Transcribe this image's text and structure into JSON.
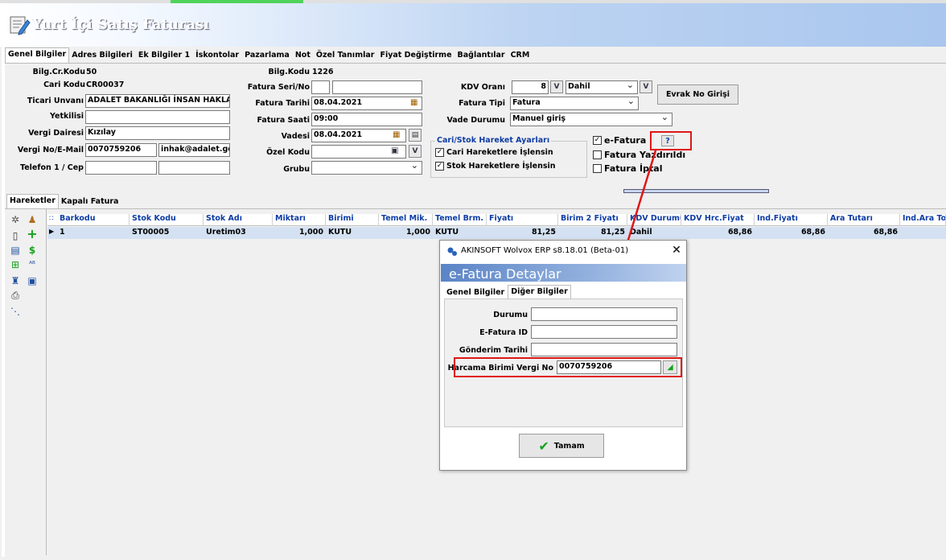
{
  "window": {
    "title": "Yurt İçi Satış Faturası"
  },
  "main_tabs": [
    "Genel Bilgiler",
    "Adres Bilgileri",
    "Ek Bilgiler 1",
    "İskontolar",
    "Pazarlama",
    "Not",
    "Özel Tanımlar",
    "Fiyat Değiştirme",
    "Bağlantılar",
    "CRM"
  ],
  "left_form": {
    "bilg_cr_kodu_label": "Bilg.Cr.Kodu",
    "bilg_cr_kodu_value": "50",
    "cari_kodu_label": "Cari Kodu",
    "cari_kodu_value": "CR00037",
    "ticari_unvani_label": "Ticari Unvanı",
    "ticari_unvani_value": "ADALET BAKANLIĞI İNSAN HAKLARI",
    "yetkilisi_label": "Yetkilisi",
    "yetkilisi_value": "",
    "vergi_dairesi_label": "Vergi Dairesi",
    "vergi_dairesi_value": "Kızılay",
    "vergi_no_label": "Vergi No/E-Mail",
    "vergi_no_value": "0070759206",
    "email_value": "inhak@adalet.gov.tr",
    "telefon_label": "Telefon 1 / Cep",
    "telefon_value": "",
    "cep_value": ""
  },
  "middle_form": {
    "bilg_kodu_label": "Bilg.Kodu",
    "bilg_kodu_value": "1226",
    "fatura_seri_label": "Fatura Seri/No",
    "fatura_seri_value": "",
    "fatura_no_value": "",
    "fatura_tarihi_label": "Fatura Tarihi",
    "fatura_tarihi_value": "08.04.2021",
    "fatura_saati_label": "Fatura Saati",
    "fatura_saati_value": "09:00",
    "vadesi_label": "Vadesi",
    "vadesi_value": "08.04.2021",
    "ozel_kodu_label": "Özel Kodu",
    "ozel_kodu_value": "",
    "grubu_label": "Grubu",
    "grubu_value": ""
  },
  "right_form": {
    "kdv_orani_label": "KDV Oranı",
    "kdv_orani_value": "8",
    "kdv_dahil_value": "Dahil",
    "fatura_tipi_label": "Fatura Tipi",
    "fatura_tipi_value": "Fatura",
    "vade_durumu_label": "Vade Durumu",
    "vade_durumu_value": "Manuel giriş",
    "evrak_button": "Evrak No Girişi",
    "v_label": "V"
  },
  "hareket_ayarlari": {
    "title": "Cari/Stok Hareket Ayarları",
    "cari_label": "Cari Hareketlere İşlensin",
    "stok_label": "Stok Hareketlere İşlensin"
  },
  "flags": {
    "efatura_label": "e-Fatura",
    "help_label": "?",
    "yazdirildi_label": "Fatura Yazdırıldı",
    "iptal_label": "Fatura İptal"
  },
  "lower_tabs": [
    "Hareketler",
    "Kapalı Fatura"
  ],
  "grid": {
    "headers": [
      "Barkodu",
      "Stok Kodu",
      "Stok Adı",
      "Miktarı",
      "Birimi",
      "Temel Mik.",
      "Temel Brm.",
      "Fiyatı",
      "Birim 2 Fiyatı",
      "KDV Durumu",
      "KDV Hrc.Fiyat",
      "İnd.Fiyatı",
      "Ara Tutarı",
      "İnd.Ara Top"
    ],
    "rows": [
      [
        "1",
        "ST00005",
        "Üretim03",
        "1,000",
        "KUTU",
        "1,000",
        "KUTU",
        "81,25",
        "81,25",
        "Dahil",
        "68,86",
        "68,86",
        "68,86",
        ""
      ]
    ]
  },
  "dialog": {
    "title": "AKINSOFT Wolvox ERP s8.18.01 (Beta-01)",
    "close": "✕",
    "band_title": "e-Fatura Detaylar",
    "tabs": [
      "Genel Bilgiler",
      "Diğer Bilgiler"
    ],
    "durumu_label": "Durumu",
    "durumu_value": "",
    "efatura_id_label": "E-Fatura ID",
    "efatura_id_value": "",
    "gonderim_label": "Gönderim Tarihi",
    "gonderim_value": "",
    "harcama_label": "Harcama Birimi Vergi No",
    "harcama_value": "0070759206",
    "ok_button": "Tamam"
  },
  "colors": {
    "annotation_red": "#e01616",
    "grid_header_text": "#0d3ca4",
    "selected_row": "#d4e1f2"
  }
}
